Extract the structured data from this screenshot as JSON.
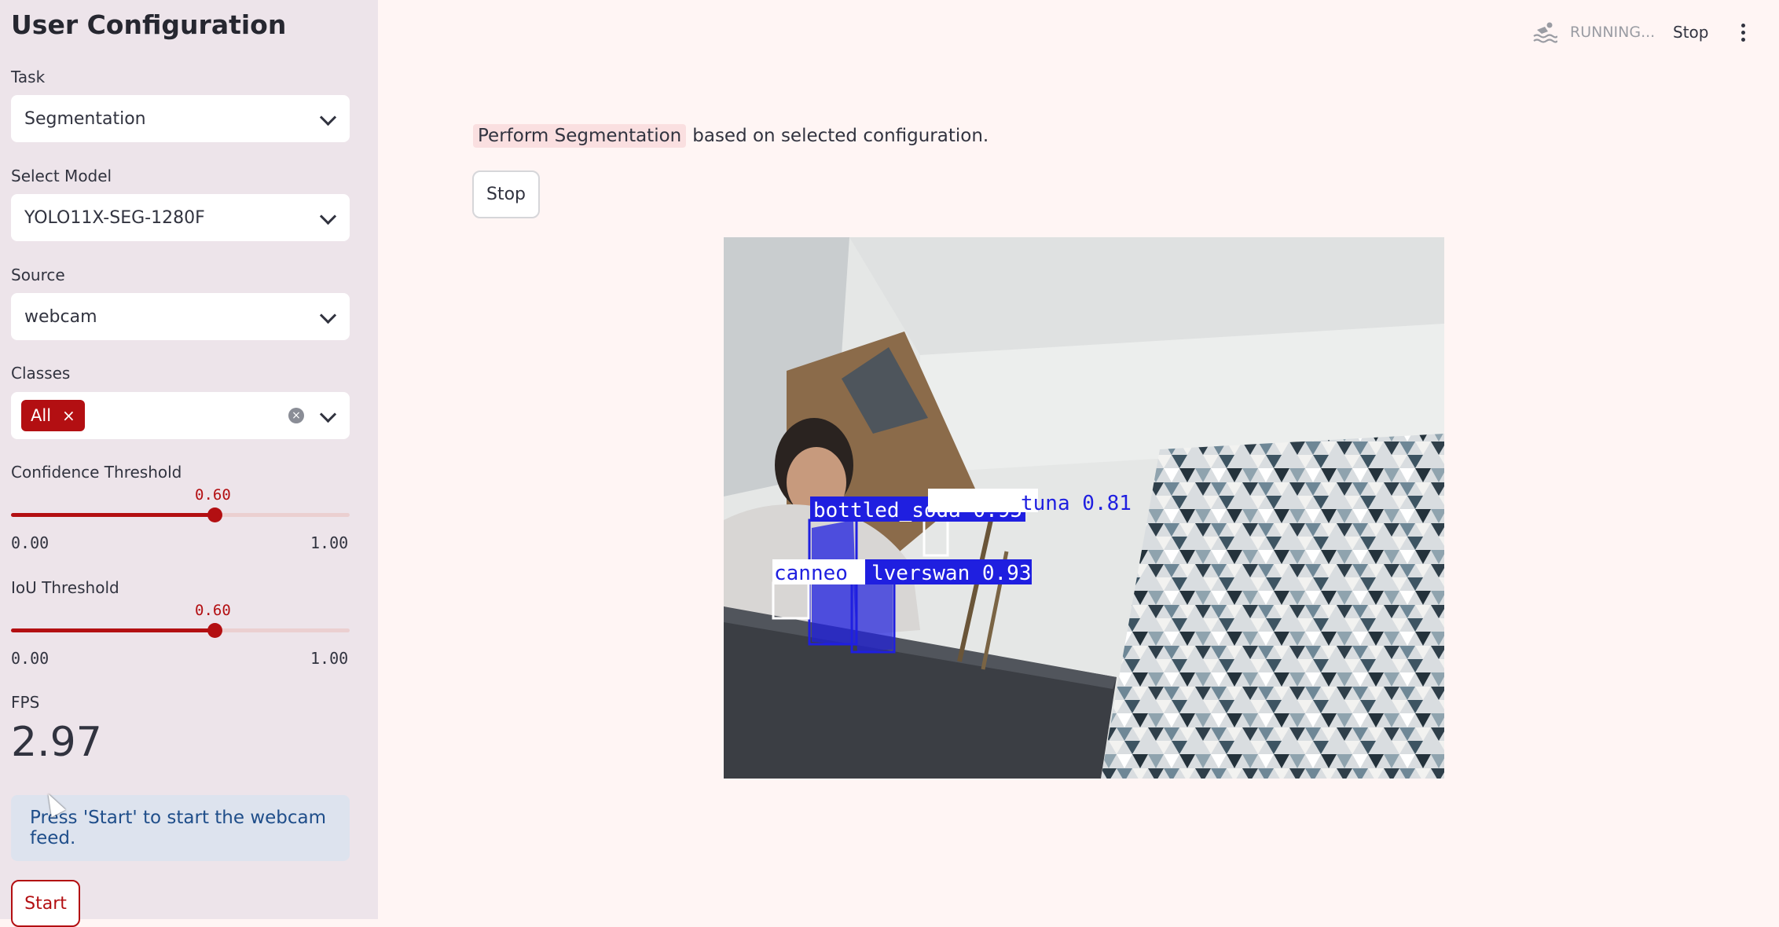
{
  "sidebar": {
    "title": "User Configuration",
    "task": {
      "label": "Task",
      "value": "Segmentation"
    },
    "model": {
      "label": "Select Model",
      "value": "YOLO11X-SEG-1280F"
    },
    "source": {
      "label": "Source",
      "value": "webcam"
    },
    "classes": {
      "label": "Classes",
      "tags": [
        "All"
      ],
      "tag_remove": "×"
    },
    "confidence": {
      "label": "Confidence Threshold",
      "value": 0.6,
      "value_text": "0.60",
      "min_text": "0.00",
      "max_text": "1.00"
    },
    "iou": {
      "label": "IoU Threshold",
      "value": 0.6,
      "value_text": "0.60",
      "min_text": "0.00",
      "max_text": "1.00"
    },
    "fps": {
      "label": "FPS",
      "value": "2.97"
    },
    "info": "Press 'Start' to start the webcam feed.",
    "start_label": "Start"
  },
  "header": {
    "status": "RUNNING...",
    "stop_label": "Stop",
    "icons": [
      "swimmer-icon",
      "kebab-menu-icon"
    ]
  },
  "main": {
    "task_highlight": "Perform Segmentation",
    "task_suffix": "based on selected configuration.",
    "stop_label": "Stop",
    "detections": [
      {
        "label": "bottled_soda 0.95"
      },
      {
        "label": "tuna 0.81"
      },
      {
        "label": "canned silverswan 0.93",
        "visible_text": "canneo",
        "visible_text_2": "lverswan 0.93"
      }
    ]
  },
  "colors": {
    "accent": "#b30f12",
    "sidebar_bg": "#ede4ea",
    "main_bg": "#fff5f4",
    "info_bg": "#dde3ee",
    "info_text": "#1f4e8a",
    "detection_box": "#1f1fe0"
  }
}
